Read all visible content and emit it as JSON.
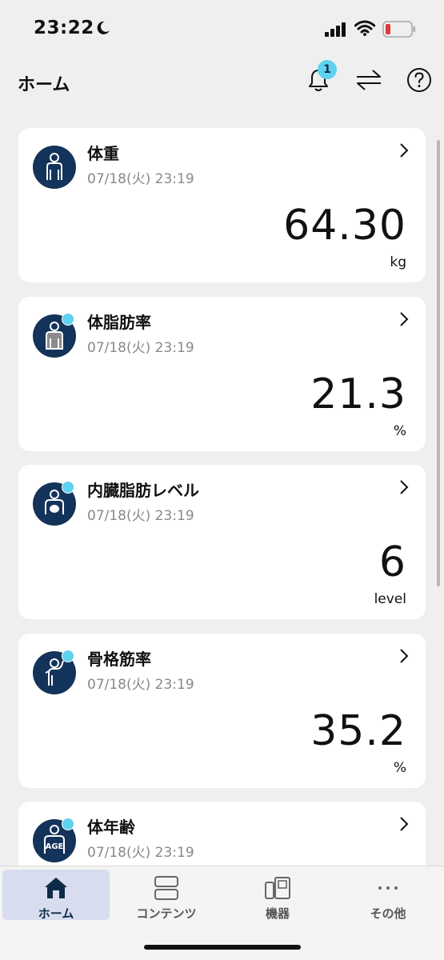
{
  "status_bar": {
    "time": "23:22"
  },
  "header": {
    "title": "ホーム",
    "notification_count": "1"
  },
  "cards": [
    {
      "label": "体重",
      "date": "07/18(火) 23:19",
      "value": "64.30",
      "unit": "kg"
    },
    {
      "label": "体脂肪率",
      "date": "07/18(火) 23:19",
      "value": "21.3",
      "unit": "%"
    },
    {
      "label": "内臓脂肪レベル",
      "date": "07/18(火) 23:19",
      "value": "6",
      "unit": "level"
    },
    {
      "label": "骨格筋率",
      "date": "07/18(火) 23:19",
      "value": "35.2",
      "unit": "%"
    },
    {
      "label": "体年齢",
      "date": "07/18(火) 23:19",
      "value": "",
      "unit": "",
      "icon_text": "AGE"
    }
  ],
  "tabs": [
    {
      "label": "ホーム"
    },
    {
      "label": "コンテンツ"
    },
    {
      "label": "機器"
    },
    {
      "label": "その他"
    }
  ],
  "colors": {
    "accent": "#5fd2ef",
    "navy": "#14335a",
    "active_tab": "#d7dcef"
  }
}
